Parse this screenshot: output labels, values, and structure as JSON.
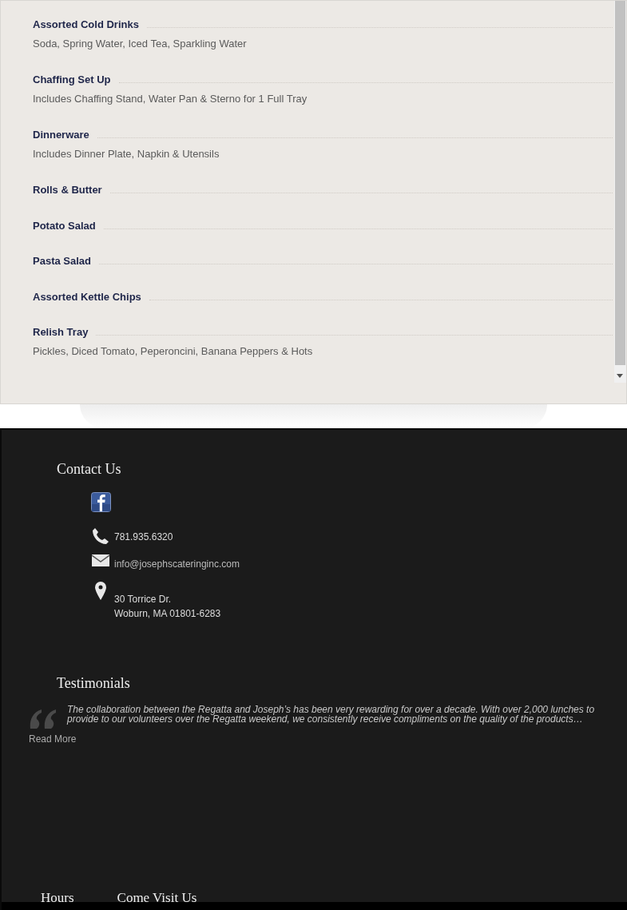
{
  "menu_items": [
    {
      "name": "Assorted Cold Drinks",
      "description": "Soda, Spring Water, Iced Tea, Sparkling Water"
    },
    {
      "name": "Chaffing Set Up",
      "description": "Includes Chaffing Stand, Water Pan & Sterno for 1 Full Tray"
    },
    {
      "name": "Dinnerware",
      "description": "Includes Dinner Plate, Napkin & Utensils"
    },
    {
      "name": "Rolls & Butter"
    },
    {
      "name": "Potato Salad"
    },
    {
      "name": "Pasta Salad"
    },
    {
      "name": "Assorted Kettle Chips"
    },
    {
      "name": "Relish Tray",
      "description": "Pickles, Diced Tomato, Peperoncini, Banana Peppers & Hots"
    }
  ],
  "contact": {
    "title": "Contact Us",
    "items": [
      {
        "kind": "facebook"
      },
      {
        "kind": "phone",
        "lines": [
          "781.935.6320"
        ]
      },
      {
        "kind": "email",
        "lines": [
          "info@josephscateringinc.com"
        ]
      },
      {
        "kind": "address",
        "lines": [
          "30 Torrice Dr.",
          "Woburn, MA 01801-6283"
        ]
      }
    ]
  },
  "testimonials": {
    "title": "Testimonials",
    "quote": "The collaboration between the Regatta and Joseph’s has been very rewarding for over a decade. With over 2,000 lunches to provide to our volunteers over the Regatta weekend, we consistently receive compliments on the quality of the products…",
    "link": "Read More"
  },
  "footer_headings": [
    "Hours",
    "Come Visit Us"
  ]
}
